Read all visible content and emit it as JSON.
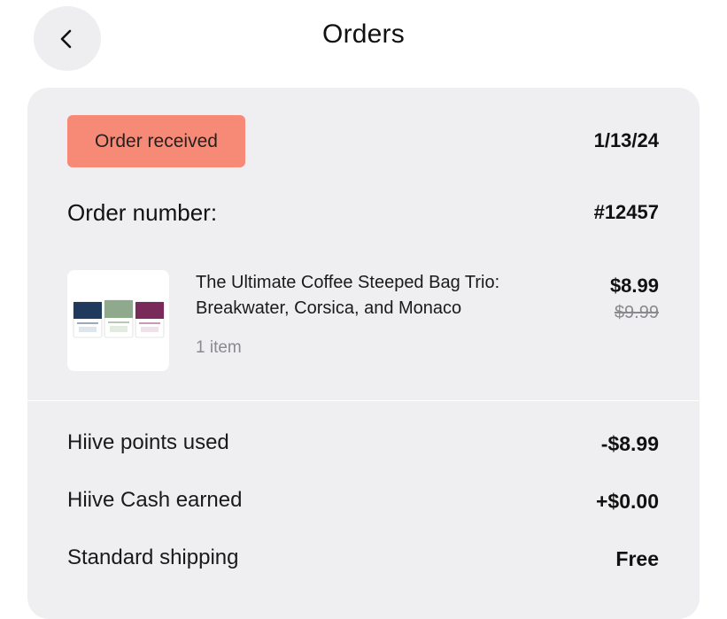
{
  "header": {
    "title": "Orders",
    "back_icon": "chevron-left-icon"
  },
  "order": {
    "status": "Order received",
    "status_color": "#f78a77",
    "date": "1/13/24",
    "number_label": "Order number:",
    "number_value": "#12457"
  },
  "product": {
    "thumbnail_icon": "coffee-bags-image",
    "name": "The Ultimate Coffee Steeped Bag Trio: Breakwater, Corsica, and Monaco",
    "quantity": "1 item",
    "price": "$8.99",
    "original_price": "$9.99"
  },
  "summary": [
    {
      "label": "Hiive points used",
      "value": "-$8.99"
    },
    {
      "label": "Hiive Cash earned",
      "value": "+$0.00"
    },
    {
      "label": "Standard shipping",
      "value": "Free"
    }
  ]
}
